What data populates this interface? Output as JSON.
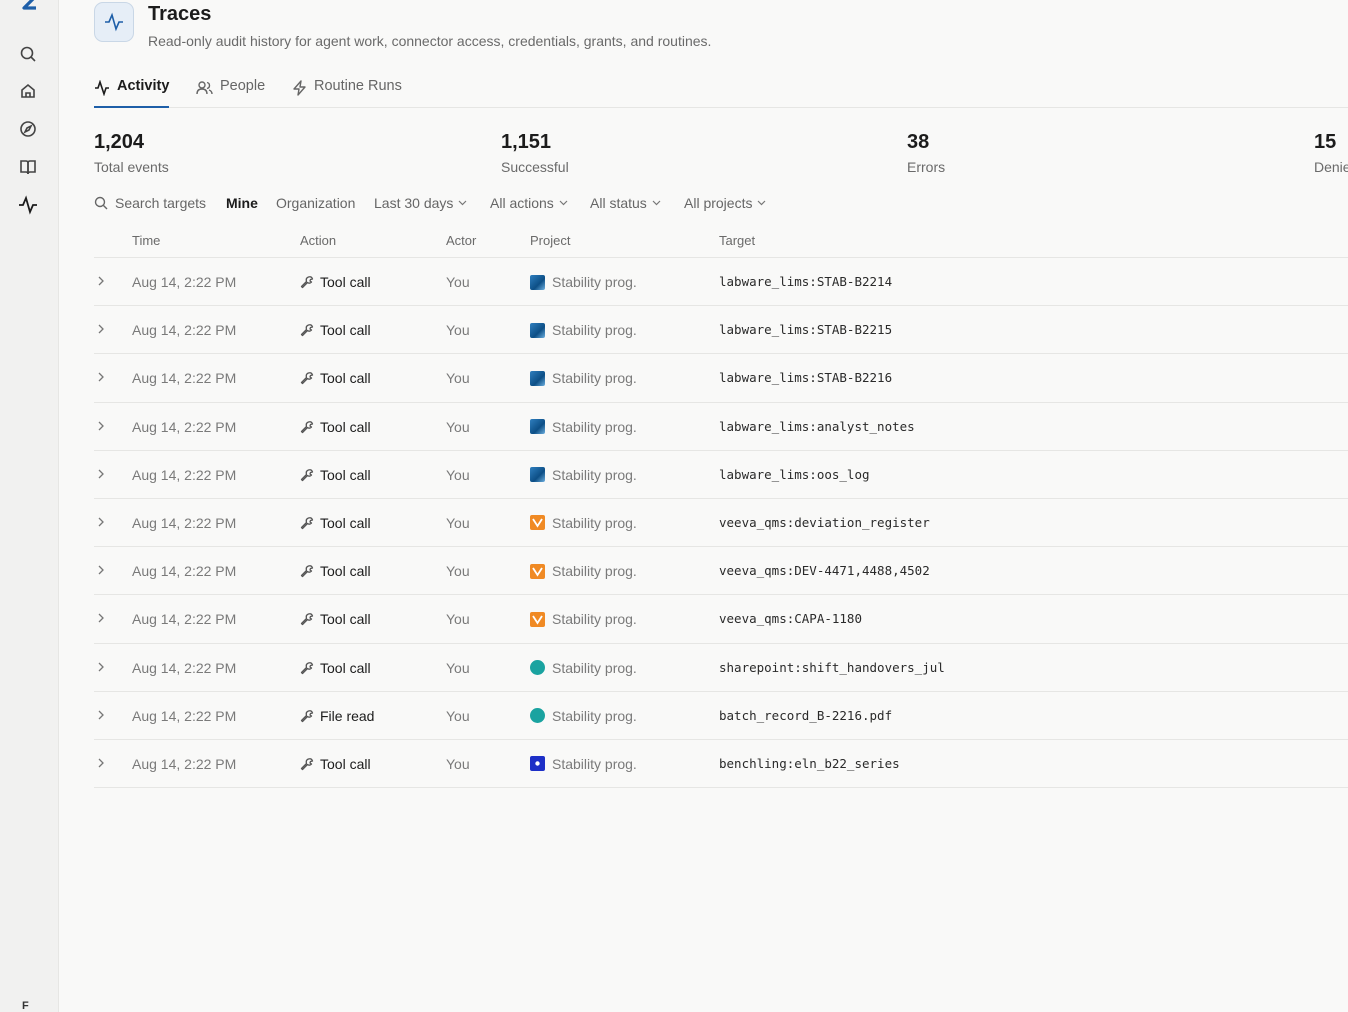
{
  "sidebar": {
    "logo_letter": "Z",
    "bottom_letter": "F",
    "icons": [
      "search-icon",
      "home-icon",
      "compass-icon",
      "book-icon",
      "activity-icon"
    ]
  },
  "header": {
    "title": "Traces",
    "subtitle": "Read-only audit history for agent work, connector access, credentials, grants, and routines."
  },
  "tabs": [
    {
      "label": "Activity",
      "icon": "activity-icon",
      "active": true
    },
    {
      "label": "People",
      "icon": "people-icon",
      "active": false
    },
    {
      "label": "Routine Runs",
      "icon": "bolt-icon",
      "active": false
    }
  ],
  "stats": [
    {
      "value": "1,204",
      "label": "Total events"
    },
    {
      "value": "1,151",
      "label": "Successful"
    },
    {
      "value": "38",
      "label": "Errors"
    },
    {
      "value": "15",
      "label": "Denied"
    }
  ],
  "filters": {
    "search_placeholder": "Search targets",
    "mine": "Mine",
    "organization": "Organization",
    "date_range": "Last 30 days",
    "actions": "All actions",
    "status": "All status",
    "projects": "All projects"
  },
  "table": {
    "columns": [
      "Time",
      "Action",
      "Actor",
      "Project",
      "Target"
    ],
    "rows": [
      {
        "time": "Aug 14, 2:22 PM",
        "action": "Tool call",
        "actor": "You",
        "project": "Stability prog.",
        "project_icon": "labware",
        "target": "labware_lims:STAB-B2214"
      },
      {
        "time": "Aug 14, 2:22 PM",
        "action": "Tool call",
        "actor": "You",
        "project": "Stability prog.",
        "project_icon": "labware",
        "target": "labware_lims:STAB-B2215"
      },
      {
        "time": "Aug 14, 2:22 PM",
        "action": "Tool call",
        "actor": "You",
        "project": "Stability prog.",
        "project_icon": "labware",
        "target": "labware_lims:STAB-B2216"
      },
      {
        "time": "Aug 14, 2:22 PM",
        "action": "Tool call",
        "actor": "You",
        "project": "Stability prog.",
        "project_icon": "labware",
        "target": "labware_lims:analyst_notes"
      },
      {
        "time": "Aug 14, 2:22 PM",
        "action": "Tool call",
        "actor": "You",
        "project": "Stability prog.",
        "project_icon": "labware",
        "target": "labware_lims:oos_log"
      },
      {
        "time": "Aug 14, 2:22 PM",
        "action": "Tool call",
        "actor": "You",
        "project": "Stability prog.",
        "project_icon": "veeva",
        "target": "veeva_qms:deviation_register"
      },
      {
        "time": "Aug 14, 2:22 PM",
        "action": "Tool call",
        "actor": "You",
        "project": "Stability prog.",
        "project_icon": "veeva",
        "target": "veeva_qms:DEV-4471,4488,4502"
      },
      {
        "time": "Aug 14, 2:22 PM",
        "action": "Tool call",
        "actor": "You",
        "project": "Stability prog.",
        "project_icon": "veeva",
        "target": "veeva_qms:CAPA-1180"
      },
      {
        "time": "Aug 14, 2:22 PM",
        "action": "Tool call",
        "actor": "You",
        "project": "Stability prog.",
        "project_icon": "sharepoint",
        "target": "sharepoint:shift_handovers_jul"
      },
      {
        "time": "Aug 14, 2:22 PM",
        "action": "File read",
        "actor": "You",
        "project": "Stability prog.",
        "project_icon": "sharepoint",
        "target": "batch_record_B-2216.pdf"
      },
      {
        "time": "Aug 14, 2:22 PM",
        "action": "Tool call",
        "actor": "You",
        "project": "Stability prog.",
        "project_icon": "benchling",
        "target": "benchling:eln_b22_series"
      }
    ]
  },
  "colors": {
    "accent": "#1e5fa8",
    "labware": "#2f7fbf",
    "veeva": "#f08a24",
    "sharepoint": "#1aa3a0",
    "benchling": "#1d2fc7"
  }
}
